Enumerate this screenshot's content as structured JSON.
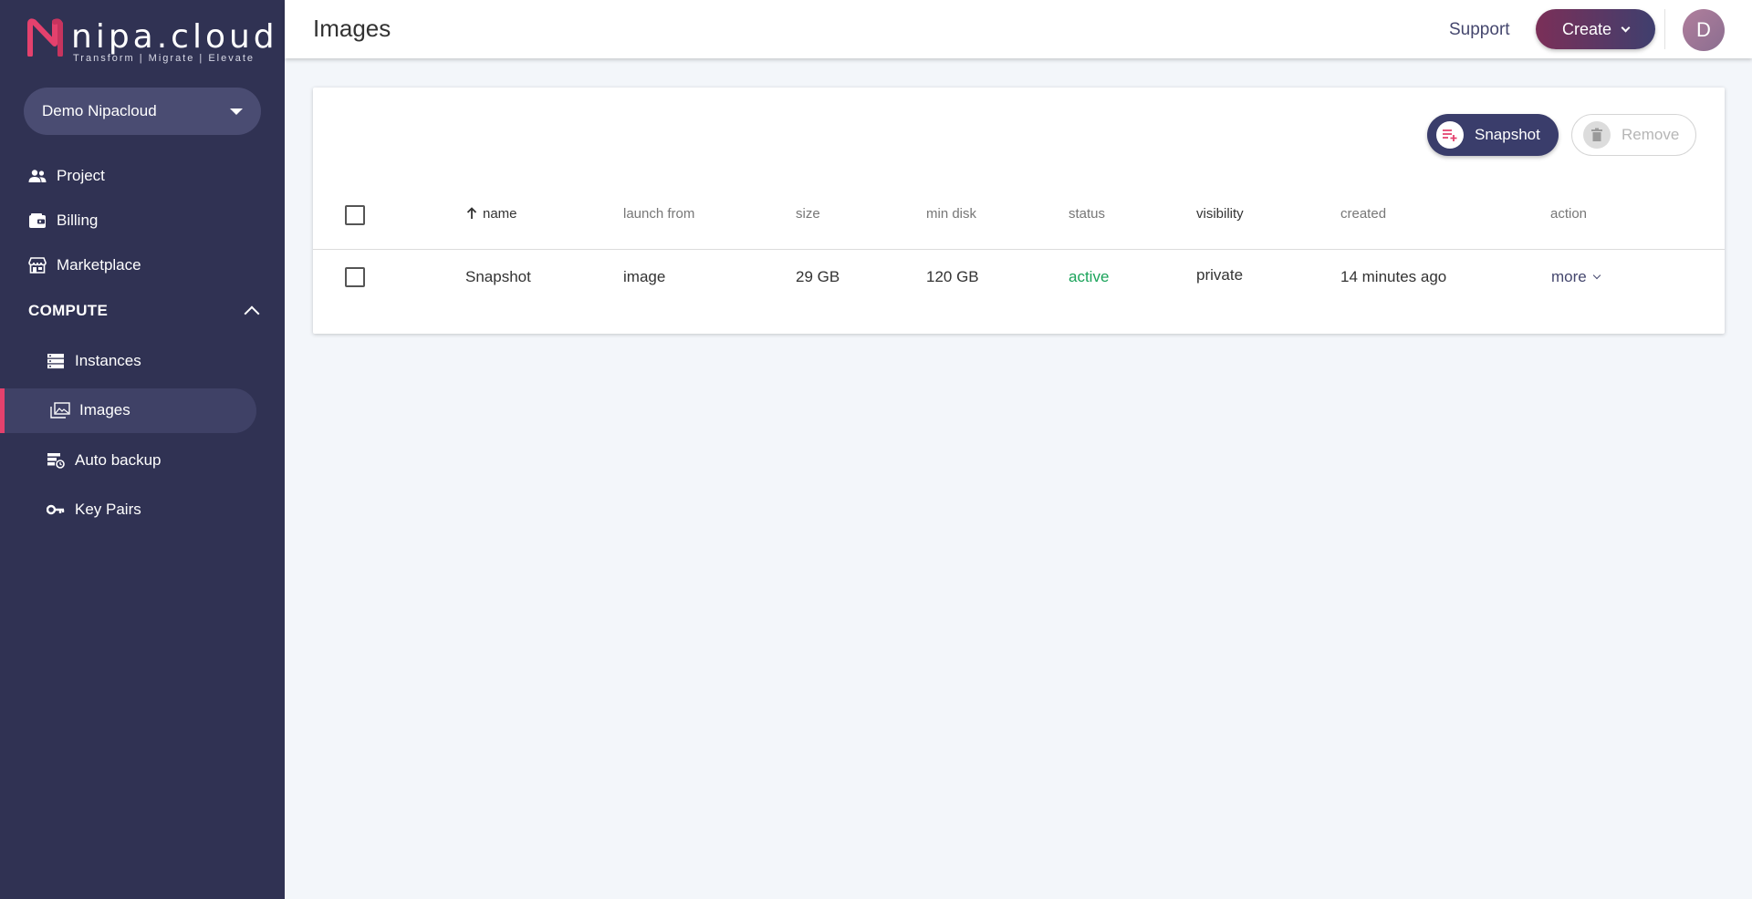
{
  "brand": {
    "name": "nipa.cloud",
    "tagline": "Transform  |  Migrate  |  Elevate",
    "accent": "#e4416d",
    "sidebar_bg": "#303253"
  },
  "sidebar": {
    "org_selector": {
      "value": "Demo Nipacloud",
      "icon": "caret-down-icon"
    },
    "top_items": [
      {
        "label": "Project",
        "icon": "people-icon"
      },
      {
        "label": "Billing",
        "icon": "wallet-icon"
      },
      {
        "label": "Marketplace",
        "icon": "store-icon"
      }
    ],
    "section": {
      "label": "COMPUTE",
      "expanded": true,
      "icon": "chevron-up-icon"
    },
    "compute_items": [
      {
        "label": "Instances",
        "icon": "server-icon",
        "active": false
      },
      {
        "label": "Images",
        "icon": "images-icon",
        "active": true
      },
      {
        "label": "Auto backup",
        "icon": "backup-icon",
        "active": false
      },
      {
        "label": "Key Pairs",
        "icon": "key-icon",
        "active": false
      }
    ]
  },
  "header": {
    "title": "Images",
    "support_label": "Support",
    "create_label": "Create",
    "avatar_initial": "D"
  },
  "toolbar": {
    "snapshot_label": "Snapshot",
    "remove_label": "Remove",
    "remove_enabled": false
  },
  "table": {
    "columns": {
      "name": "name",
      "launch_from": "launch from",
      "size": "size",
      "min_disk": "min disk",
      "status": "status",
      "visibility": "visibility",
      "created": "created",
      "action": "action"
    },
    "sort": {
      "column": "name",
      "direction": "ascending"
    },
    "rows": [
      {
        "name": "Snapshot",
        "launch_from": "image",
        "size": "29 GB",
        "min_disk": "120 GB",
        "status": "active",
        "visibility": "private",
        "created": "14 minutes ago",
        "action": "more"
      }
    ]
  }
}
